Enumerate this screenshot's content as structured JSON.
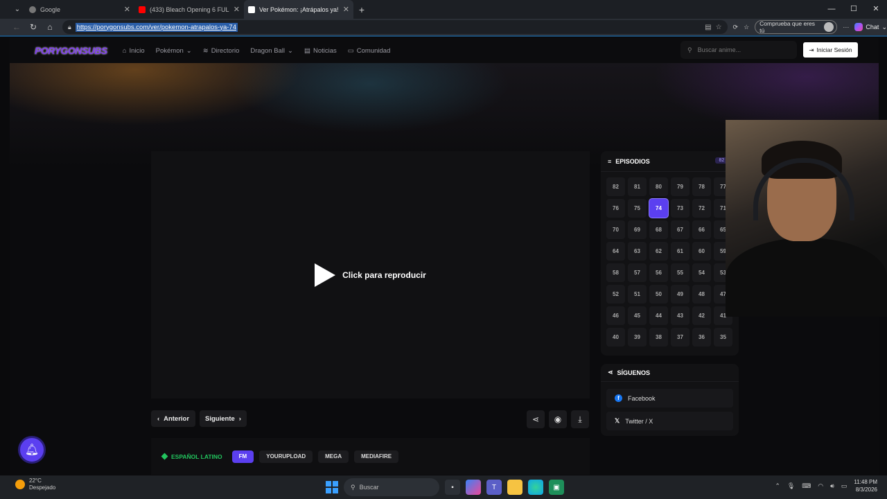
{
  "browser": {
    "tabs": [
      {
        "title": "Google",
        "favicon_color": "#777777"
      },
      {
        "title": "(433) Bleach Opening 6 FULL - Ali",
        "favicon_color": "#ff0000"
      },
      {
        "title": "Ver Pokémon: ¡Atrápalos ya! capít",
        "favicon_color": "#ffffff"
      }
    ],
    "url": "https://porygonsubs.com/ver/pokemon-atrapalos-ya-74",
    "verify_label": "Comprueba que eres tú",
    "chat_label": "Chat"
  },
  "site": {
    "logo": "PORYGONSUBS",
    "nav": [
      "Inicio",
      "Pokémon",
      "Directorio",
      "Dragon Ball",
      "Noticias",
      "Comunidad"
    ],
    "search_placeholder": "Buscar anime...",
    "login_label": "Iniciar Sesión"
  },
  "player": {
    "play_label": "Click para reproducir",
    "prev_label": "Anterior",
    "next_label": "Siguiente"
  },
  "servers": {
    "language": "ESPAÑOL LATINO",
    "options": [
      "FM",
      "YOURUPLOAD",
      "MEGA",
      "MEDIAFIRE"
    ],
    "active": "FM"
  },
  "episodes": {
    "heading": "EPISODIOS",
    "count": "82 / 8",
    "current": "74",
    "list": [
      "82",
      "81",
      "80",
      "79",
      "78",
      "77",
      "76",
      "75",
      "74",
      "73",
      "72",
      "71",
      "70",
      "69",
      "68",
      "67",
      "66",
      "65",
      "64",
      "63",
      "62",
      "61",
      "60",
      "59",
      "58",
      "57",
      "56",
      "55",
      "54",
      "53",
      "52",
      "51",
      "50",
      "49",
      "48",
      "47",
      "46",
      "45",
      "44",
      "43",
      "42",
      "41",
      "40",
      "39",
      "38",
      "37",
      "36",
      "35"
    ]
  },
  "social": {
    "heading": "SÍGUENOS",
    "links": [
      "Facebook",
      "Twitter / X"
    ]
  },
  "taskbar": {
    "temperature": "22°C",
    "weather": "Despejado",
    "search_label": "Buscar",
    "time": "11:48 PM",
    "date": "8/3/2026"
  },
  "colors": {
    "accent": "#5b3ff0",
    "lang_green": "#22c55e"
  }
}
